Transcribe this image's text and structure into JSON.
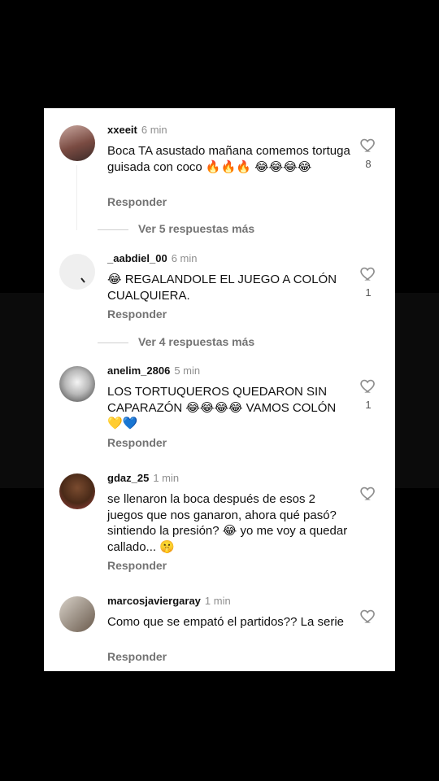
{
  "comments": [
    {
      "username": "xxeeit",
      "time": "6 min",
      "text": "Boca TA asustado mañana comemos tortuga guisada con coco 🔥🔥🔥 😂😂😂😂",
      "reply": "Responder",
      "likes": "8"
    },
    {
      "username": "_aabdiel_00",
      "time": "6 min",
      "text": "😂 REGALANDOLE EL JUEGO A COLÓN CUALQUIERA.",
      "reply": "Responder",
      "likes": "1"
    },
    {
      "username": "anelim_2806",
      "time": "5 min",
      "text": "LOS TORTUQUEROS QUEDARON SIN CAPARAZÓN 😂😂😂😂 VAMOS COLÓN 💛💙",
      "reply": "Responder",
      "likes": "1"
    },
    {
      "username": "gdaz_25",
      "time": "1 min",
      "text": "se llenaron la boca después de esos 2 juegos que nos ganaron, ahora qué pasó? sintiendo la presión? 😂 yo me voy a quedar callado... 🤫",
      "reply": "Responder",
      "likes": ""
    },
    {
      "username": "marcosjaviergaray",
      "time": "1 min",
      "text": "Como que se empató el partidos?? La serie",
      "reply": "Responder",
      "likes": ""
    }
  ],
  "more_replies": [
    "Ver 5 respuestas más",
    "Ver 4 respuestas más"
  ],
  "colors": {
    "background": "#000000",
    "card": "#ffffff",
    "text": "#111111",
    "muted": "#8e8e8e"
  },
  "icons": {
    "like": "heart-outline-icon"
  }
}
